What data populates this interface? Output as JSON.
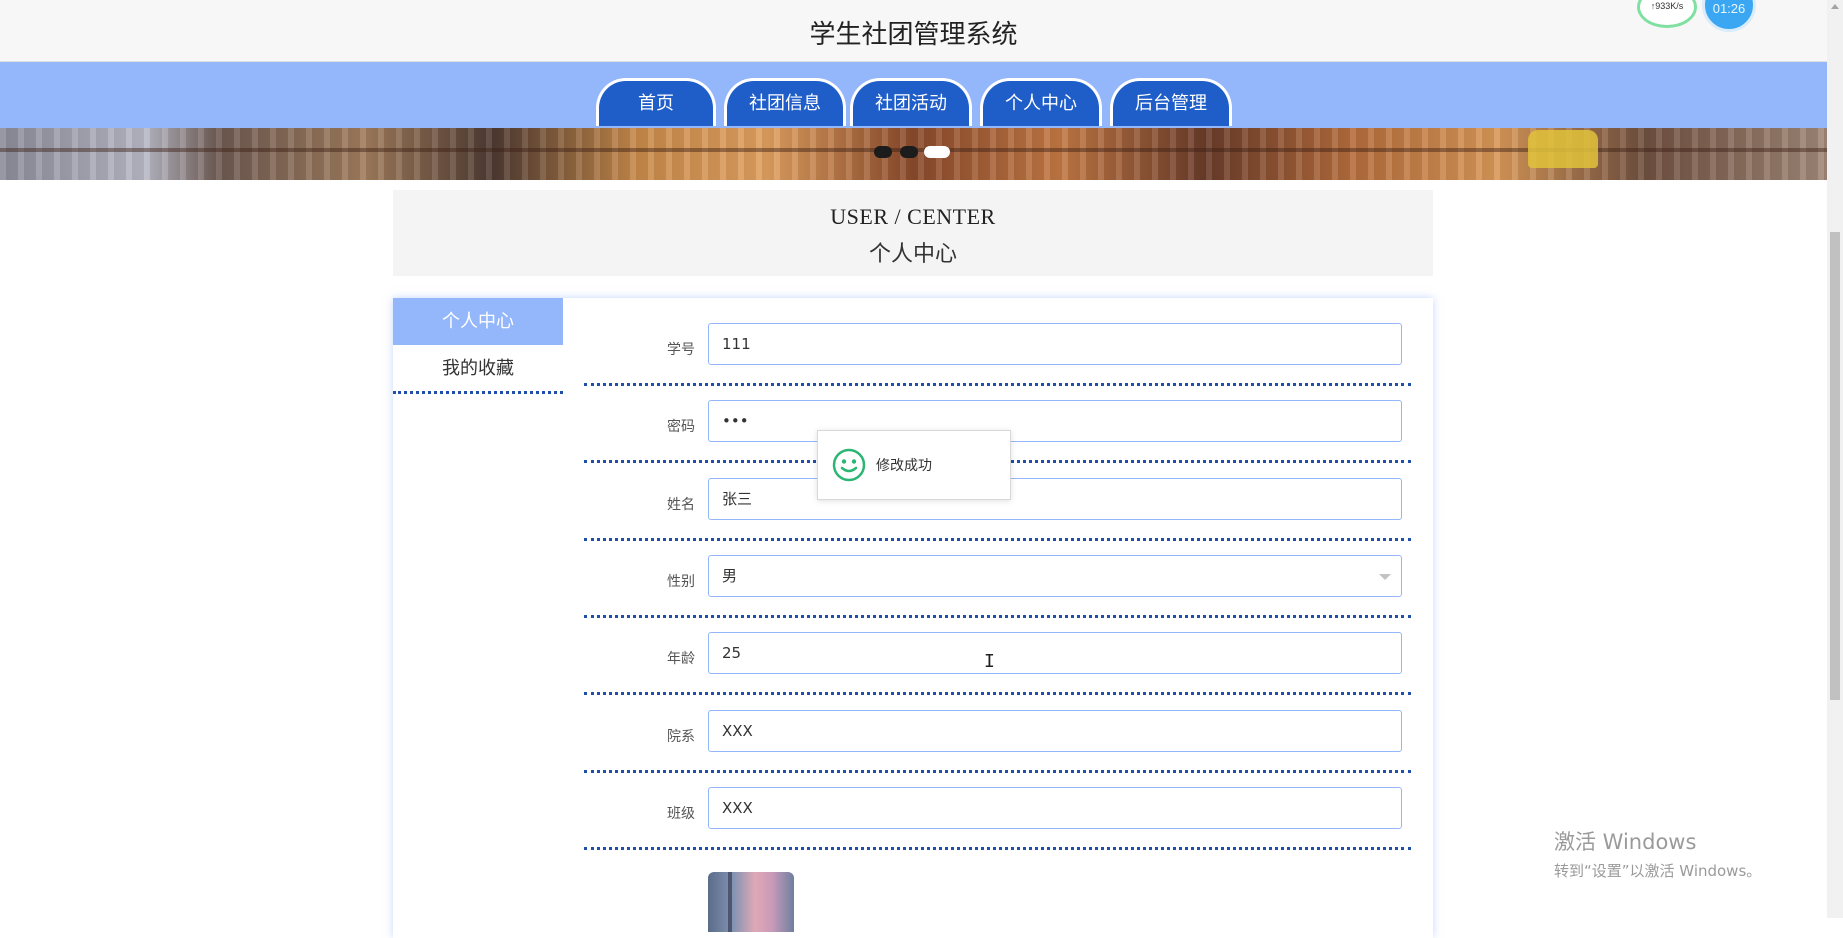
{
  "header": {
    "title": "学生社团管理系统",
    "net_speed": "↑933K/s",
    "clock": "01:26"
  },
  "nav": {
    "tabs": [
      {
        "label": "首页"
      },
      {
        "label": "社团信息"
      },
      {
        "label": "社团活动"
      },
      {
        "label": "个人中心"
      },
      {
        "label": "后台管理"
      }
    ]
  },
  "carousel": {
    "slide_count": 3,
    "active_index": 2
  },
  "section": {
    "title_en": "USER / CENTER",
    "title_cn": "个人中心"
  },
  "sidebar": {
    "items": [
      {
        "label": "个人中心",
        "active": true
      },
      {
        "label": "我的收藏",
        "active": false
      }
    ]
  },
  "form": {
    "fields": [
      {
        "label": "学号",
        "value": "111"
      },
      {
        "label": "密码",
        "value": "•••"
      },
      {
        "label": "姓名",
        "value": "张三"
      },
      {
        "label": "性别",
        "value": "男"
      },
      {
        "label": "年龄",
        "value": "25"
      },
      {
        "label": "院系",
        "value": "XXX"
      },
      {
        "label": "班级",
        "value": "XXX"
      }
    ]
  },
  "toast": {
    "message": "修改成功",
    "icon": "smiley-icon"
  },
  "watermark": {
    "line1": "激活 Windows",
    "line2": "转到“设置”以激活 Windows。"
  },
  "colors": {
    "nav_background": "#94b6fb",
    "tab_fill": "#1f5ec9",
    "divider": "#1f4fa8",
    "success_icon": "#2bb673"
  }
}
